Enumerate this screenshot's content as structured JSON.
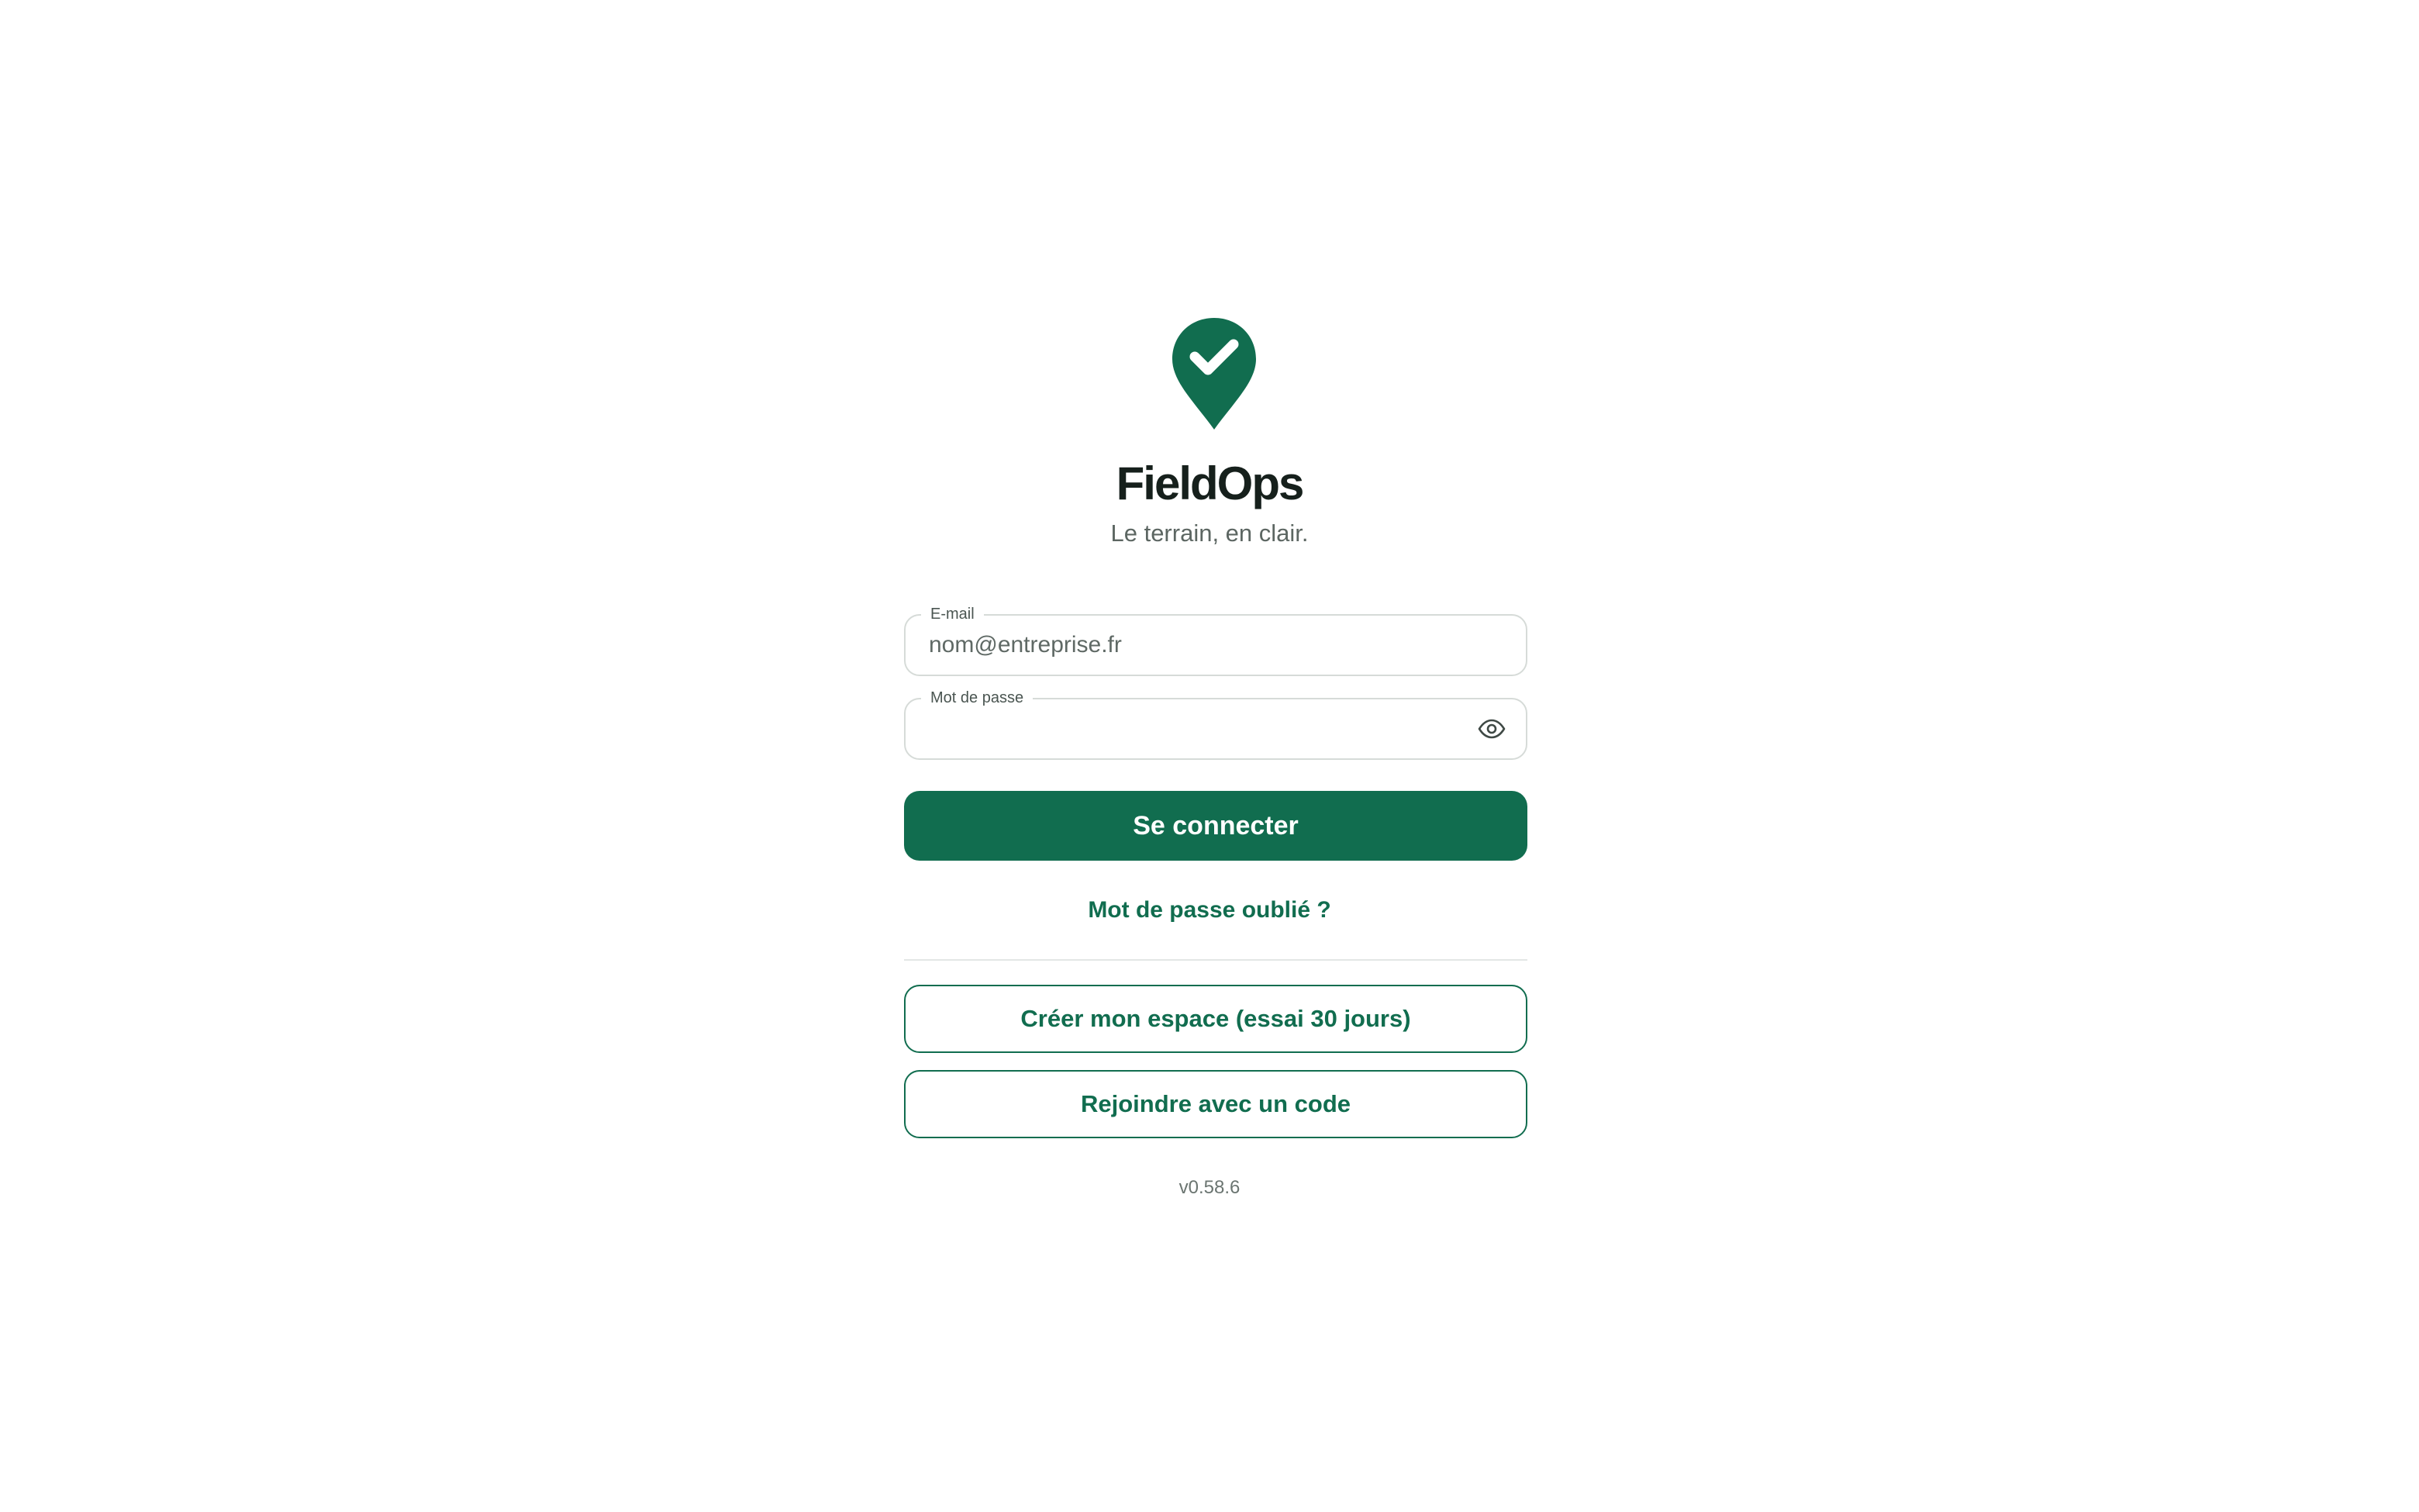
{
  "brand": {
    "app_name": "FieldOps",
    "tagline": "Le terrain, en clair.",
    "logo_icon": "map-pin-check-icon",
    "accent_color": "#116d4f"
  },
  "login_form": {
    "email": {
      "label": "E-mail",
      "placeholder": "nom@entreprise.fr",
      "value": ""
    },
    "password": {
      "label": "Mot de passe",
      "value": "",
      "toggle_icon": "eye-icon"
    },
    "submit_label": "Se connecter",
    "forgot_password_label": "Mot de passe oublié ?"
  },
  "secondary_actions": {
    "create_space_label": "Créer mon espace (essai 30 jours)",
    "join_with_code_label": "Rejoindre avec un code"
  },
  "footer": {
    "version": "v0.58.6"
  }
}
